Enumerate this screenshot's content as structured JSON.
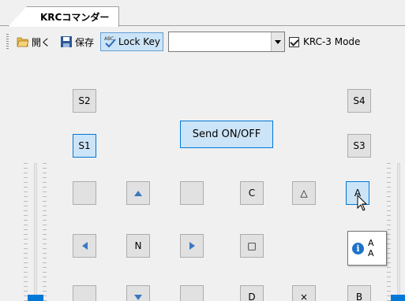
{
  "tab": {
    "label": "KRCコマンダー"
  },
  "toolbar": {
    "open_label": "開く",
    "save_label": "保存",
    "lock_key_label": "Lock Key",
    "combo_value": "",
    "mode_checkbox_label": "KRC-3 Mode",
    "mode_checked": true
  },
  "buttons": {
    "s1": "S1",
    "s2": "S2",
    "s3": "S3",
    "s4": "S4",
    "send": "Send ON/OFF",
    "n": "N",
    "c": "C",
    "d": "D",
    "a": "A",
    "b": "B",
    "triangle": "△",
    "square": "□",
    "cross": "×"
  },
  "tooltip": {
    "line1": "A",
    "line2": "A"
  },
  "colors": {
    "accent": "#0078d7",
    "button_face": "#e1e1e1",
    "highlight": "#cce4f7",
    "arrow": "#3a78c2"
  }
}
